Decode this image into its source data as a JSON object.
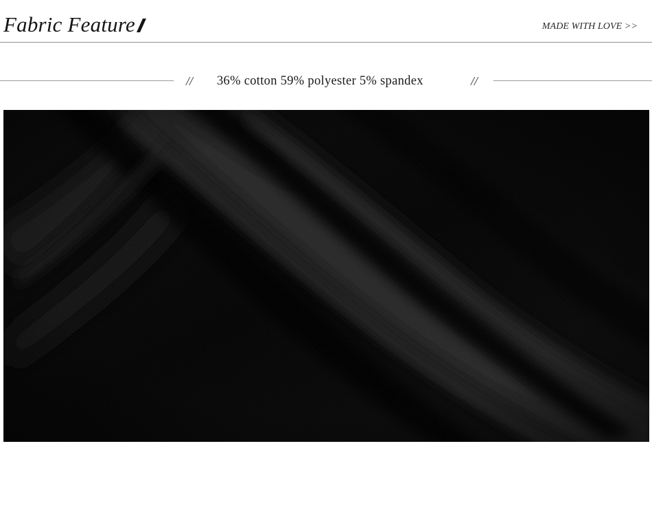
{
  "header": {
    "title": "Fabric Feature",
    "title_slash_icon": "slash-icon",
    "tagline": "MADE WITH LOVE >>"
  },
  "composition": {
    "left_mark": "//",
    "text": "36% cotton 59% polyester 5% spandex",
    "right_mark": "//"
  },
  "photo": {
    "subject": "black-fabric-folds-image",
    "colors": {
      "base": "#050505",
      "highlight": "#2a2a2a",
      "shadow": "#000000"
    }
  }
}
